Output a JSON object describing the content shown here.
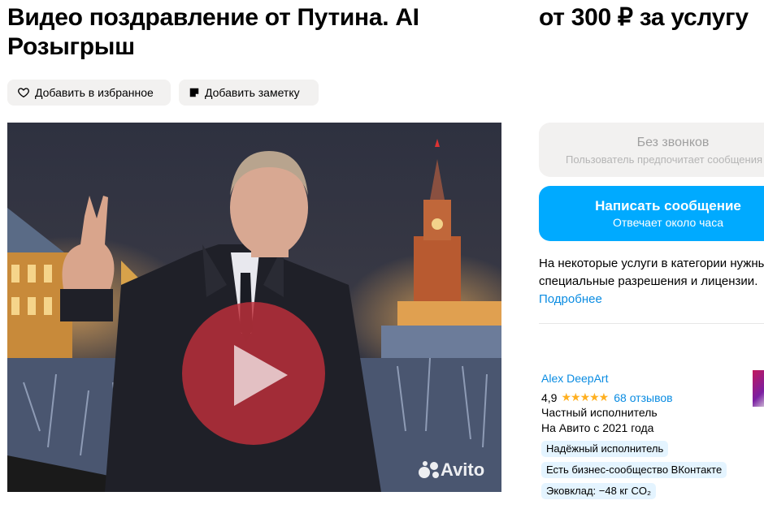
{
  "listing": {
    "title": "Видео поздравление от Путина. AI Розыгрыш",
    "price": "от 300 ₽ за услугу"
  },
  "actions": {
    "favorite_label": "Добавить в избранное",
    "note_label": "Добавить заметку"
  },
  "media": {
    "watermark": "Avito",
    "play_icon": "play-icon"
  },
  "contact": {
    "no_calls_title": "Без звонков",
    "no_calls_subtitle": "Пользователь предпочитает сообщения",
    "message_title": "Написать сообщение",
    "message_subtitle": "Отвечает около часа"
  },
  "notice": {
    "line1": "На некоторые услуги в категории нужны",
    "line2": "специальные разрешения и лицензии.",
    "link": "Подробнее"
  },
  "seller": {
    "name": "Alex DeepArt",
    "rating": "4,9",
    "stars": "★★★★★",
    "reviews": "68 отзывов",
    "type": "Частный исполнитель",
    "since": "На Авито с 2021 года",
    "badges": [
      "Надёжный исполнитель",
      "Есть бизнес-сообщество ВКонтакте",
      "Эковклад: −48 кг CO₂"
    ]
  },
  "colors": {
    "accent": "#00aaff",
    "link": "#0a8ce2",
    "star": "#ffb021",
    "play": "#c0303a"
  }
}
